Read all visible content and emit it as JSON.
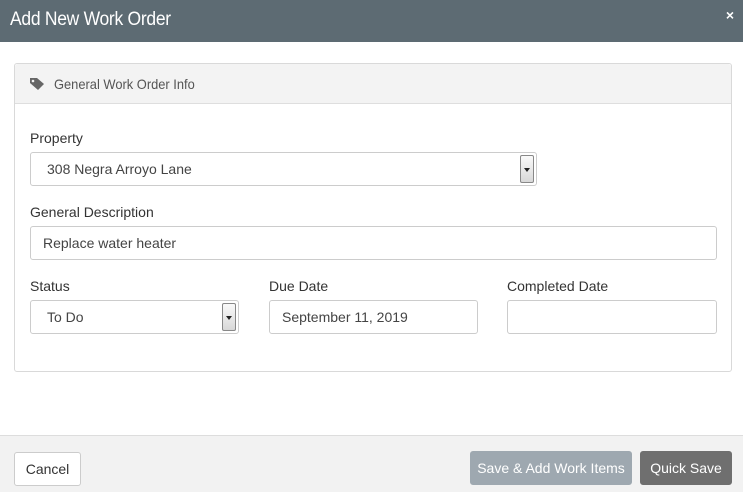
{
  "dialog": {
    "title": "Add New Work Order",
    "close_glyph": "×"
  },
  "panel": {
    "title": "General Work Order Info",
    "icon": "tag-icon"
  },
  "form": {
    "property": {
      "label": "Property",
      "value": "308 Negra Arroyo Lane"
    },
    "description": {
      "label": "General Description",
      "value": "Replace water heater"
    },
    "status": {
      "label": "Status",
      "value": "To Do"
    },
    "due_date": {
      "label": "Due Date",
      "value": "September 11, 2019"
    },
    "completed_date": {
      "label": "Completed Date",
      "value": ""
    }
  },
  "footer": {
    "cancel_label": "Cancel",
    "save_add_label": "Save & Add Work Items",
    "quick_save_label": "Quick Save"
  },
  "colors": {
    "titlebar": "#5d6b73",
    "save_add_button": "#9ea8b0",
    "quick_save_button": "#6f6f6f"
  }
}
